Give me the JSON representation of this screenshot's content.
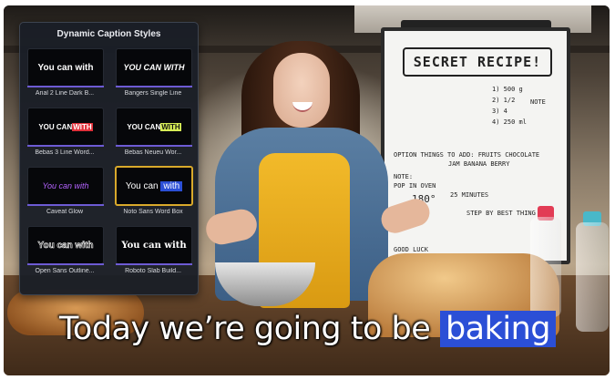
{
  "panel": {
    "title": "Dynamic Caption Styles",
    "styles": [
      {
        "preview": "You can with",
        "label": "Arial 2 Line Dark B..."
      },
      {
        "preview": "YOU CAN WITH",
        "label": "Bangers Single Line"
      },
      {
        "preview_a": "YOU CAN",
        "preview_b": "WITH",
        "label": "Bebas 3 Line Word..."
      },
      {
        "preview_a": "YOU CAN",
        "preview_b": "WITH",
        "label": "Bebas Neueu Wor..."
      },
      {
        "preview": "You can with",
        "label": "Caveat Glow"
      },
      {
        "preview_a": "You can",
        "preview_b": "with",
        "label": "Noto Sans Word Box",
        "selected": true
      },
      {
        "preview": "You can with",
        "label": "Open Sans Outline..."
      },
      {
        "preview": "You can with",
        "label": "Roboto Slab Build..."
      }
    ]
  },
  "board": {
    "title": "SECRET RECIPE!",
    "notes": [
      "1) 500 g",
      "2) 1/2",
      "3) 4",
      "4) 250 ml",
      "NOTE",
      "OPTION THINGS TO ADD: FRUITS CHOCOLATE",
      "JAM BANANA BERRY",
      "NOTE:",
      "POP IN OVEN",
      "180°",
      "25 MINUTES",
      "STEP BY BEST THING",
      "GOOD LUCK"
    ]
  },
  "caption": {
    "text": "Today we’re going to be",
    "highlight": "baking"
  },
  "colors": {
    "highlight_blue": "#2b4fd6",
    "selection_gold": "#d9a92b",
    "underline_purple": "#6d5bd4"
  }
}
